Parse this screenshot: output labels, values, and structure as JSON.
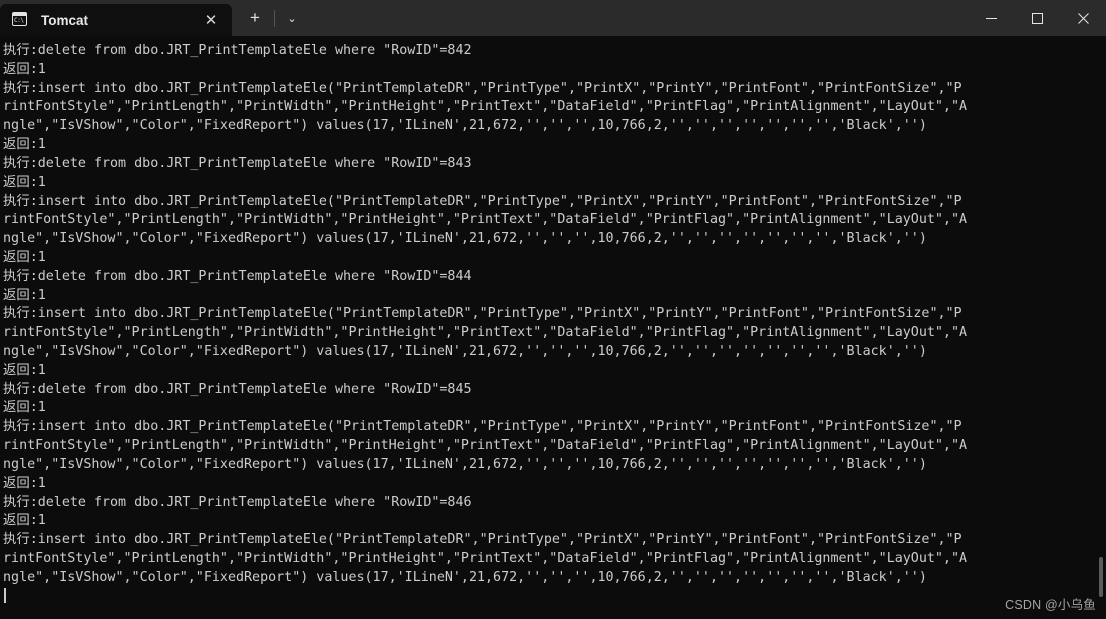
{
  "window": {
    "controls": {
      "minimize_label": "Minimize",
      "maximize_label": "Maximize",
      "close_label": "Close"
    }
  },
  "tabbar": {
    "tab": {
      "title": "Tomcat",
      "icon": "console-cmd-icon",
      "icon_text": "C:\\",
      "close_label": "✕"
    },
    "new_tab_label": "+",
    "dropdown_label": "⌄"
  },
  "terminal": {
    "prefix_execute": "执行:",
    "prefix_return": "返回:1",
    "row_ids": [
      842,
      843,
      844,
      845,
      846
    ],
    "insert_values": "(17,'ILineN',21,672,'','','',10,766,2,'','','','','','','','Black','')",
    "lines": [
      "执行:delete from dbo.JRT_PrintTemplateEle where \"RowID\"=842",
      "返回:1",
      "执行:insert into dbo.JRT_PrintTemplateEle(\"PrintTemplateDR\",\"PrintType\",\"PrintX\",\"PrintY\",\"PrintFont\",\"PrintFontSize\",\"P",
      "rintFontStyle\",\"PrintLength\",\"PrintWidth\",\"PrintHeight\",\"PrintText\",\"DataField\",\"PrintFlag\",\"PrintAlignment\",\"LayOut\",\"A",
      "ngle\",\"IsVShow\",\"Color\",\"FixedReport\") values(17,'ILineN',21,672,'','','',10,766,2,'','','','','','','','Black','')",
      "返回:1",
      "执行:delete from dbo.JRT_PrintTemplateEle where \"RowID\"=843",
      "返回:1",
      "执行:insert into dbo.JRT_PrintTemplateEle(\"PrintTemplateDR\",\"PrintType\",\"PrintX\",\"PrintY\",\"PrintFont\",\"PrintFontSize\",\"P",
      "rintFontStyle\",\"PrintLength\",\"PrintWidth\",\"PrintHeight\",\"PrintText\",\"DataField\",\"PrintFlag\",\"PrintAlignment\",\"LayOut\",\"A",
      "ngle\",\"IsVShow\",\"Color\",\"FixedReport\") values(17,'ILineN',21,672,'','','',10,766,2,'','','','','','','','Black','')",
      "返回:1",
      "执行:delete from dbo.JRT_PrintTemplateEle where \"RowID\"=844",
      "返回:1",
      "执行:insert into dbo.JRT_PrintTemplateEle(\"PrintTemplateDR\",\"PrintType\",\"PrintX\",\"PrintY\",\"PrintFont\",\"PrintFontSize\",\"P",
      "rintFontStyle\",\"PrintLength\",\"PrintWidth\",\"PrintHeight\",\"PrintText\",\"DataField\",\"PrintFlag\",\"PrintAlignment\",\"LayOut\",\"A",
      "ngle\",\"IsVShow\",\"Color\",\"FixedReport\") values(17,'ILineN',21,672,'','','',10,766,2,'','','','','','','','Black','')",
      "返回:1",
      "执行:delete from dbo.JRT_PrintTemplateEle where \"RowID\"=845",
      "返回:1",
      "执行:insert into dbo.JRT_PrintTemplateEle(\"PrintTemplateDR\",\"PrintType\",\"PrintX\",\"PrintY\",\"PrintFont\",\"PrintFontSize\",\"P",
      "rintFontStyle\",\"PrintLength\",\"PrintWidth\",\"PrintHeight\",\"PrintText\",\"DataField\",\"PrintFlag\",\"PrintAlignment\",\"LayOut\",\"A",
      "ngle\",\"IsVShow\",\"Color\",\"FixedReport\") values(17,'ILineN',21,672,'','','',10,766,2,'','','','','','','','Black','')",
      "返回:1",
      "执行:delete from dbo.JRT_PrintTemplateEle where \"RowID\"=846",
      "返回:1",
      "执行:insert into dbo.JRT_PrintTemplateEle(\"PrintTemplateDR\",\"PrintType\",\"PrintX\",\"PrintY\",\"PrintFont\",\"PrintFontSize\",\"P",
      "rintFontStyle\",\"PrintLength\",\"PrintWidth\",\"PrintHeight\",\"PrintText\",\"DataField\",\"PrintFlag\",\"PrintAlignment\",\"LayOut\",\"A",
      "ngle\",\"IsVShow\",\"Color\",\"FixedReport\") values(17,'ILineN',21,672,'','','',10,766,2,'','','','','','','','Black','')"
    ]
  },
  "watermark": {
    "text": "CSDN @小乌鱼"
  },
  "colors": {
    "titlebar_bg": "#2b2b2b",
    "tab_active_bg": "#0f0f0f",
    "terminal_bg": "#0c0c0c",
    "terminal_fg": "#cccccc"
  }
}
